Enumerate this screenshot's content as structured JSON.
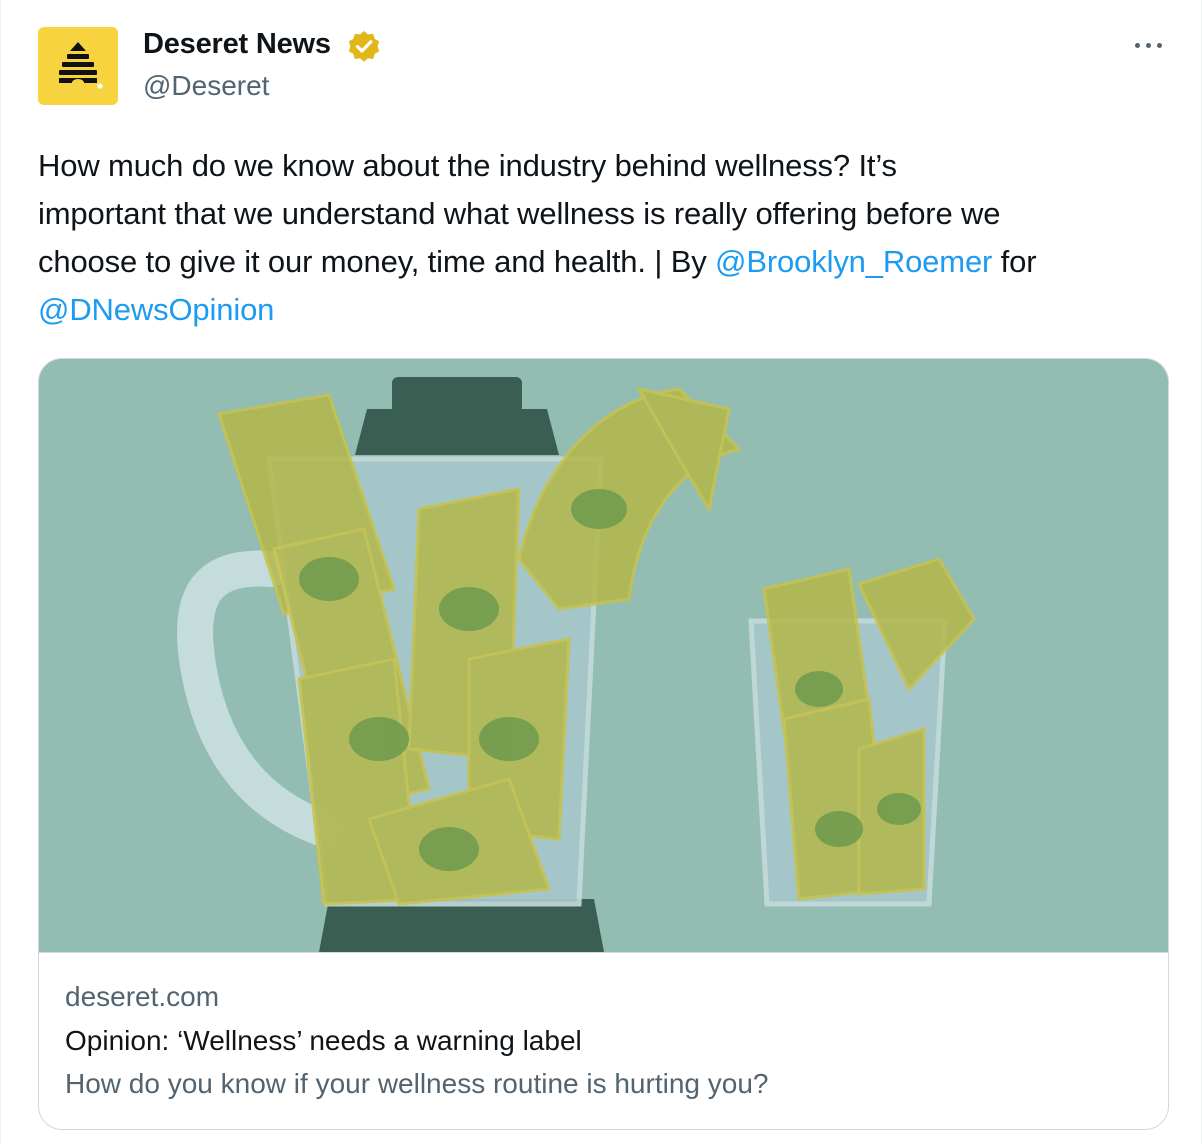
{
  "author": {
    "display_name": "Deseret News",
    "handle": "@Deseret",
    "verified": true,
    "avatar_icon": "beehive-icon",
    "avatar_color": "#f6d33f"
  },
  "tweet": {
    "lines": [
      [
        {
          "text": "How much do we know about the industry behind wellness? It’s"
        }
      ],
      [
        {
          "text": "important that we understand what wellness is really offering before we"
        }
      ],
      [
        {
          "text": "choose to give it our money, time and health. | By "
        },
        {
          "text": "@Brooklyn_Roemer",
          "mention": true
        },
        {
          "text": " for"
        }
      ],
      [
        {
          "text": "@DNewsOpinion",
          "mention": true
        }
      ]
    ]
  },
  "card": {
    "image_description": "blender-and-glass-full-of-dollar-bills-illustration",
    "domain": "deseret.com",
    "title": "Opinion: ‘Wellness’ needs a warning label",
    "description": "How do you know if your wellness routine is hurting you?"
  },
  "colors": {
    "link": "#1d9bf0",
    "secondary_text": "#536471",
    "verified_badge": "#e2b719",
    "image_background": "#93bdb3"
  },
  "icons": {
    "more": "more-horizontal-icon",
    "verified": "verified-badge-icon"
  }
}
